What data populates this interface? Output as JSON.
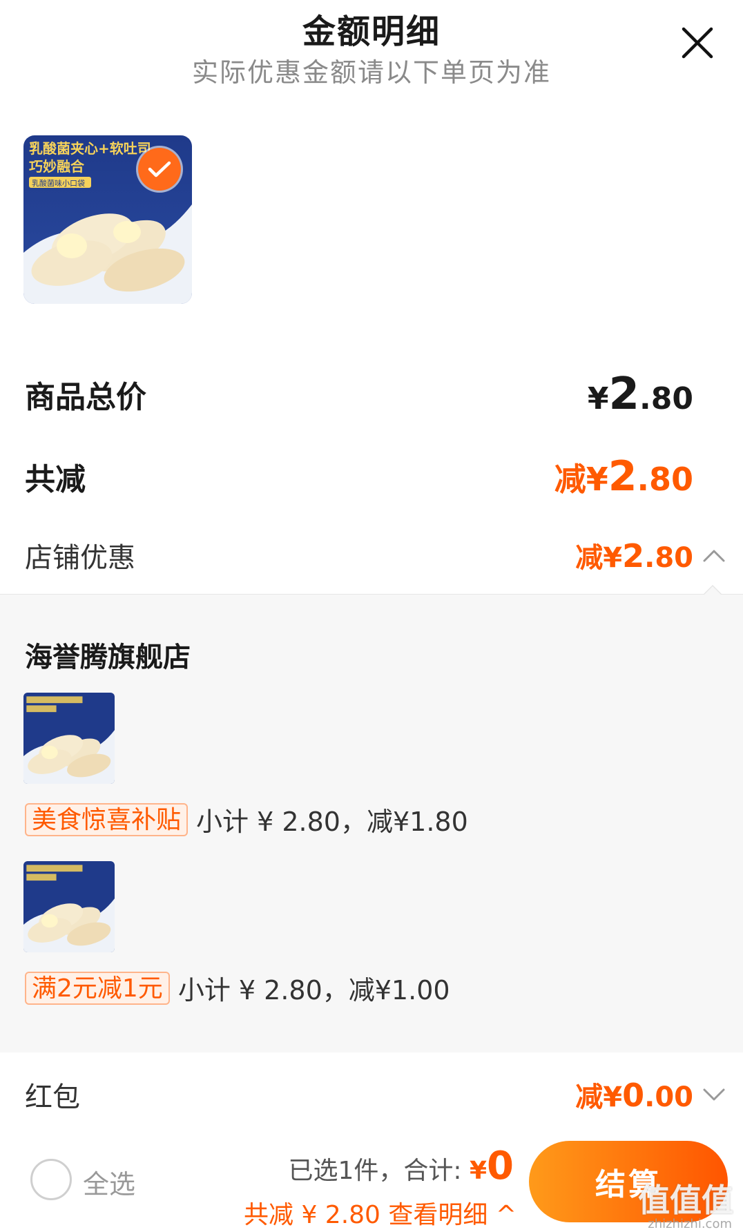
{
  "header": {
    "title": "金额明细",
    "subtitle": "实际优惠金额请以下单页为准"
  },
  "product": {
    "image_text_line1": "乳酸菌夹心+软吐司",
    "image_text_line2": "巧妙融合",
    "image_text_line3": "乳酸菌味小口袋",
    "selected": true
  },
  "summary": {
    "total_label": "商品总价",
    "total_price_yen": "¥",
    "total_price_int": "2",
    "total_price_dec": ".80",
    "discount_label": "共减",
    "discount_prefix": "减¥",
    "discount_int": "2",
    "discount_dec": ".80",
    "store_discount_label": "店铺优惠",
    "store_discount_prefix": "减¥",
    "store_discount_int": "2",
    "store_discount_dec": ".80"
  },
  "store": {
    "name": "海誉腾旗舰店",
    "promos": [
      {
        "tag": "美食惊喜补贴",
        "text": "小计 ¥ 2.80，减¥1.80"
      },
      {
        "tag": "满2元减1元",
        "text": "小计 ¥ 2.80，减¥1.00"
      }
    ]
  },
  "hongbao": {
    "label": "红包",
    "prefix": "减¥",
    "int": "0",
    "dec": ".00"
  },
  "bottom_bar": {
    "select_all_label": "全选",
    "selected_count_text": "已选1件，合计: ",
    "total_yen": "¥",
    "total_value": "0",
    "saved_text": "共减 ¥ 2.80  查看明细 ^",
    "checkout_label": "结算",
    "watermark": "值值值",
    "watermark_url": "zhizhizhi.com"
  },
  "colors": {
    "accent": "#ff5a00",
    "checkout_gradient_start": "#ff9a1a",
    "checkout_gradient_end": "#ff5500",
    "panel_bg": "#f7f7f7"
  }
}
